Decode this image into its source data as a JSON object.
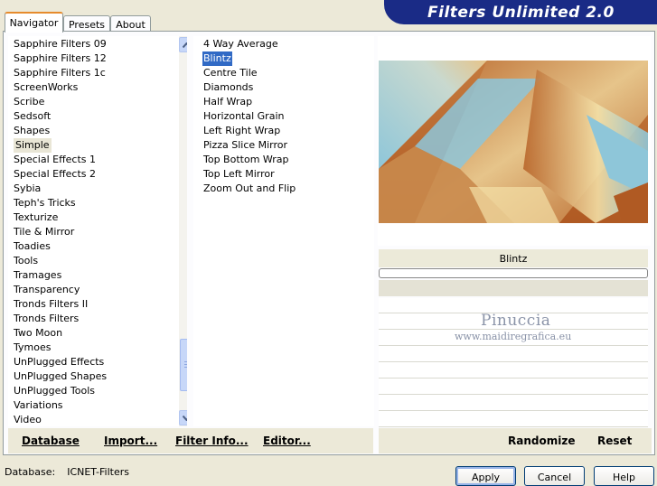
{
  "window": {
    "banner_title": "Filters Unlimited 2.0"
  },
  "tabs": [
    {
      "label": "Navigator",
      "active": true
    },
    {
      "label": "Presets",
      "active": false
    },
    {
      "label": "About",
      "active": false
    }
  ],
  "categories": {
    "items": [
      "Sapphire Filters 09",
      "Sapphire Filters 12",
      "Sapphire Filters 1c",
      "ScreenWorks",
      "Scribe",
      "Sedsoft",
      "Shapes",
      "Simple",
      "Special Effects 1",
      "Special Effects 2",
      "Sybia",
      "Teph's Tricks",
      "Texturize",
      "Tile & Mirror",
      "Toadies",
      "Tools",
      "Tramages",
      "Transparency",
      "Tronds Filters II",
      "Tronds Filters",
      "Two Moon",
      "Tymoes",
      "UnPlugged Effects",
      "UnPlugged Shapes",
      "UnPlugged Tools",
      "Variations",
      "Video"
    ],
    "selected": "Simple"
  },
  "filters": {
    "items": [
      "4 Way Average",
      "Blintz",
      "Centre Tile",
      "Diamonds",
      "Half Wrap",
      "Horizontal Grain",
      "Left Right Wrap",
      "Pizza Slice Mirror",
      "Top Bottom Wrap",
      "Top Left Mirror",
      "Zoom Out and Flip"
    ],
    "selected": "Blintz"
  },
  "preview": {
    "filter_name": "Blintz",
    "watermark_name": "Pinuccia",
    "watermark_url": "www.maidiregrafica.eu",
    "colors": {
      "brown": "#b8652a",
      "tan": "#e6c48a",
      "blue": "#8ec6d9",
      "cream": "#f3dfa6"
    }
  },
  "left_links": {
    "database": "Database",
    "import": "Import...",
    "filter_info": "Filter Info...",
    "editor": "Editor..."
  },
  "right_links": {
    "randomize": "Randomize",
    "reset": "Reset"
  },
  "status": {
    "database_label": "Database:",
    "database_value": "ICNET-Filters"
  },
  "buttons": {
    "apply": "Apply",
    "cancel": "Cancel",
    "help": "Help"
  }
}
